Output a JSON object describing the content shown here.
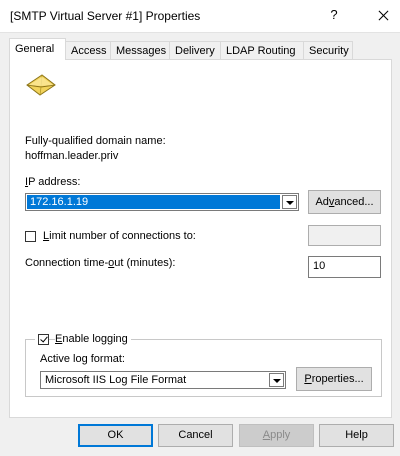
{
  "window": {
    "title": "[SMTP Virtual Server #1] Properties",
    "help": "?"
  },
  "tabs": [
    {
      "label": "General",
      "active": true
    },
    {
      "label": "Access",
      "active": false
    },
    {
      "label": "Messages",
      "active": false
    },
    {
      "label": "Delivery",
      "active": false
    },
    {
      "label": "LDAP Routing",
      "active": false
    },
    {
      "label": "Security",
      "active": false
    }
  ],
  "general": {
    "icon": "smtp-envelope-icon",
    "fqdn_label": "Fully-qualified domain name:",
    "fqdn_value": "hoffman.leader.priv",
    "ip": {
      "label_mnemonic": "I",
      "label_rest": "P address:",
      "value": "172.16.1.19",
      "advanced_mnemonic": "v",
      "advanced_pre": "Ad",
      "advanced_post": "anced..."
    },
    "limit": {
      "mnemonic": "L",
      "label_rest": "imit number of connections to:",
      "checked": false,
      "value": ""
    },
    "timeout": {
      "label_pre": "Connection time-",
      "mnemonic": "o",
      "label_post": "ut (minutes):",
      "value": "10"
    },
    "logging": {
      "mnemonic": "E",
      "label_rest": "nable logging",
      "checked": true,
      "format_label": "Active log format:",
      "format_value": "Microsoft IIS Log File Format",
      "properties_mnemonic": "P",
      "properties_rest": "roperties..."
    }
  },
  "footer": {
    "ok": "OK",
    "cancel": "Cancel",
    "apply_mnemonic": "A",
    "apply_rest": "pply",
    "help": "Help"
  },
  "colors": {
    "selection": "#0078d7",
    "dialog_bg": "#f0f0f0"
  }
}
